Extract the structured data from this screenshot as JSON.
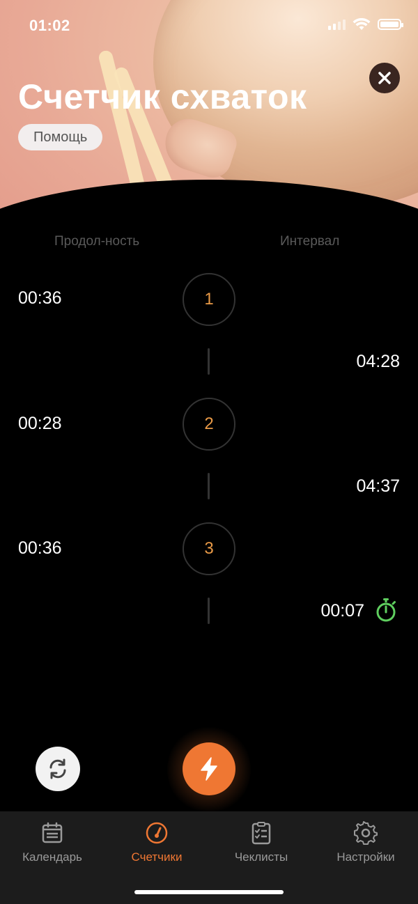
{
  "status_bar": {
    "time": "01:02"
  },
  "header": {
    "title": "Счетчик схваток",
    "help_label": "Помощь"
  },
  "columns": {
    "duration": "Продол-ность",
    "interval": "Интервал"
  },
  "contractions": [
    {
      "number": "1",
      "duration": "00:36"
    },
    {
      "number": "2",
      "duration": "00:28"
    },
    {
      "number": "3",
      "duration": "00:36"
    }
  ],
  "intervals": [
    "04:28",
    "04:37",
    "00:07"
  ],
  "colors": {
    "accent": "#ef7733",
    "number": "#e99a47",
    "running": "#5fcf5f",
    "tabbar": "#1c1c1c"
  },
  "tabs": [
    {
      "label": "Календарь",
      "icon": "calendar-icon",
      "active": false
    },
    {
      "label": "Счетчики",
      "icon": "gauge-icon",
      "active": true
    },
    {
      "label": "Чеклисты",
      "icon": "checklist-icon",
      "active": false
    },
    {
      "label": "Настройки",
      "icon": "gear-icon",
      "active": false
    }
  ]
}
